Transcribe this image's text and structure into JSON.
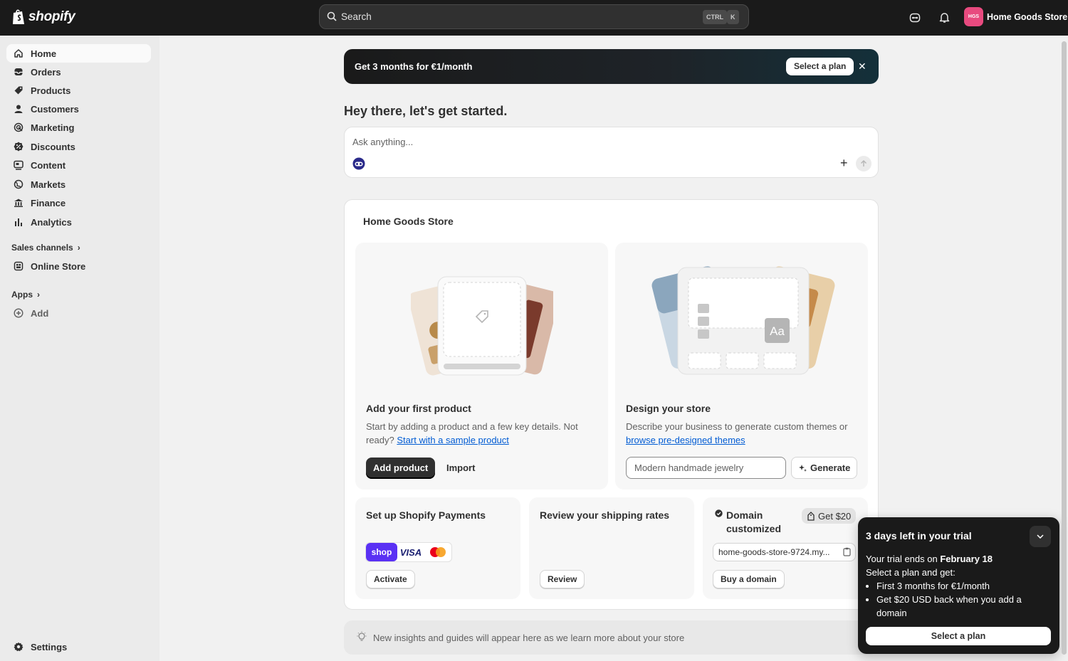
{
  "topbar": {
    "logo_text": "shopify",
    "search_placeholder": "Search",
    "shortcut_ctrl": "CTRL",
    "shortcut_key": "K",
    "store_initials": "HGS",
    "store_name": "Home Goods Store"
  },
  "sidebar": {
    "items": [
      {
        "label": "Home",
        "icon": "home-icon"
      },
      {
        "label": "Orders",
        "icon": "inbox-icon"
      },
      {
        "label": "Products",
        "icon": "tag-icon"
      },
      {
        "label": "Customers",
        "icon": "person-icon"
      },
      {
        "label": "Marketing",
        "icon": "target-icon"
      },
      {
        "label": "Discounts",
        "icon": "discount-icon"
      },
      {
        "label": "Content",
        "icon": "content-icon"
      },
      {
        "label": "Markets",
        "icon": "globe-icon"
      },
      {
        "label": "Finance",
        "icon": "bank-icon"
      },
      {
        "label": "Analytics",
        "icon": "chart-icon"
      }
    ],
    "sales_channels_label": "Sales channels",
    "online_store_label": "Online Store",
    "apps_label": "Apps",
    "add_label": "Add",
    "settings_label": "Settings"
  },
  "banner": {
    "text": "Get 3 months for €1/month",
    "button": "Select a plan",
    "close": "✕"
  },
  "greeting": "Hey there, let's get started.",
  "ask": {
    "placeholder": "Ask anything...",
    "plus": "+"
  },
  "setup": {
    "store_title": "Home Goods Store",
    "product": {
      "title": "Add your first product",
      "desc": "Start by adding a product and a few key details. Not ready?",
      "link": "Start with a sample product",
      "primary": "Add product",
      "secondary": "Import"
    },
    "design": {
      "title": "Design your store",
      "desc": "Describe your business to generate custom themes or",
      "link": "browse pre-designed themes",
      "input_placeholder": "Modern handmade jewelry",
      "button": "Generate",
      "preview_text": "Aa"
    },
    "payments": {
      "title": "Set up Shopify Payments",
      "logos": [
        "shop",
        "VISA"
      ],
      "button": "Activate"
    },
    "shipping": {
      "title": "Review your shipping rates",
      "button": "Review"
    },
    "domain": {
      "title": "Domain customized",
      "badge": "Get $20",
      "value": "home-goods-store-9724.my...",
      "button": "Buy a domain"
    }
  },
  "insights": "New insights and guides will appear here as we learn more about your store",
  "trial": {
    "title": "3 days left in your trial",
    "ends_prefix": "Your trial ends on ",
    "ends_date": "February 18",
    "select_line": "Select a plan and get:",
    "bullets": [
      "First 3 months for €1/month",
      "Get $20 USD back when you add a domain"
    ],
    "button": "Select a plan"
  },
  "colors": {
    "topbar": "#1a1a1a",
    "accent_link": "#005bd3",
    "avatar": "#e84a7f",
    "shop_pay": "#5a31f4"
  }
}
